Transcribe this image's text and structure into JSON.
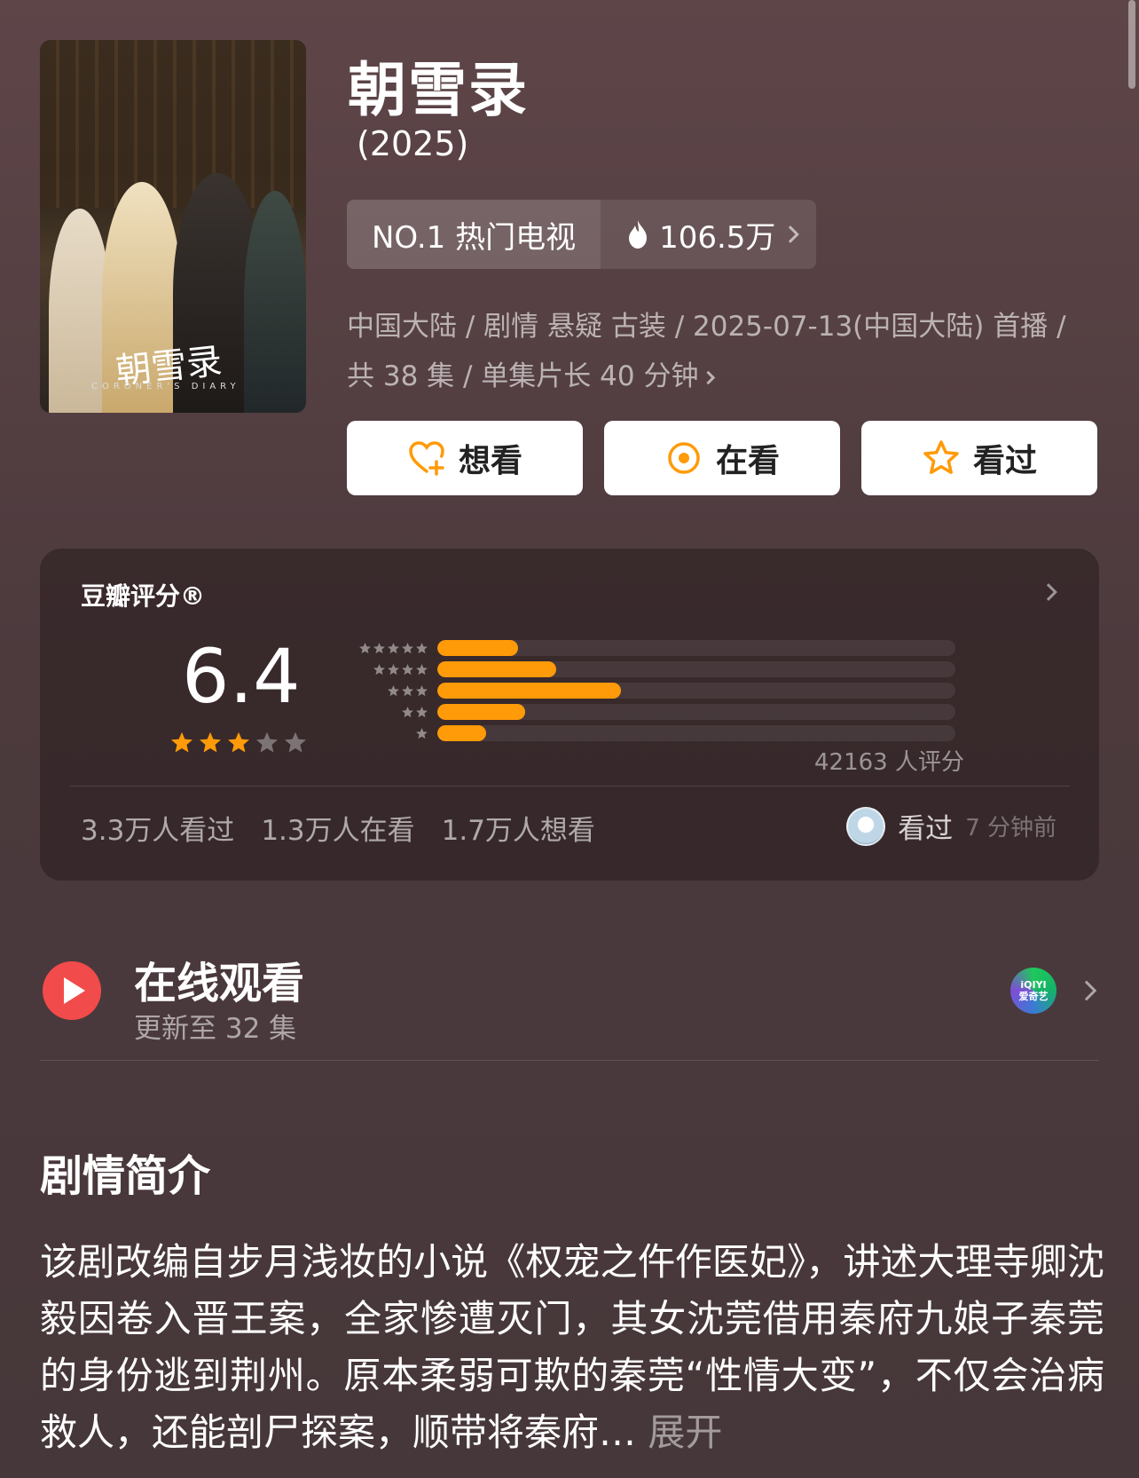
{
  "show": {
    "title": "朝雪录",
    "year": "(2025)",
    "poster_title": "朝雪录",
    "poster_subtitle": "CORONER'S DIARY"
  },
  "rank": {
    "label": "NO.1 热门电视",
    "heat": "106.5万"
  },
  "meta": {
    "line": "中国大陆 / 剧情 悬疑 古装 / 2025-07-13(中国大陆) 首播 / 共 38 集 / 单集片长 40 分钟"
  },
  "actions": {
    "want": "想看",
    "watching": "在看",
    "watched": "看过"
  },
  "rating": {
    "label": "豆瓣评分®",
    "score": "6.4",
    "stars": 3,
    "votes": "42163 人评分",
    "distribution": [
      {
        "stars": 5,
        "fraction": 0.155
      },
      {
        "stars": 4,
        "fraction": 0.23
      },
      {
        "stars": 3,
        "fraction": 0.355
      },
      {
        "stars": 2,
        "fraction": 0.17
      },
      {
        "stars": 1,
        "fraction": 0.095
      }
    ],
    "watched_count": "3.3万人看过",
    "watching_count": "1.3万人在看",
    "want_count": "1.7万人想看",
    "friend_status": "看过",
    "friend_time": "7 分钟前"
  },
  "watch": {
    "title": "在线观看",
    "subtitle": "更新至 32 集",
    "platform": "爱奇艺",
    "platform_mark": "iQIYI"
  },
  "synopsis": {
    "heading": "剧情简介",
    "text": "该剧改编自步月浅妆的小说《权宠之仵作医妃》，讲述大理寺卿沈毅因卷入晋王案，全家惨遭灭门，其女沈莞借用秦府九娘子秦莞的身份逃到荆州。原本柔弱可欺的秦莞“性情大变”，不仅会治病救人，还能剖尸探案，顺带将秦府…",
    "more": "展开"
  },
  "colors": {
    "accent": "#ff9a08",
    "play": "#f24b4b"
  }
}
